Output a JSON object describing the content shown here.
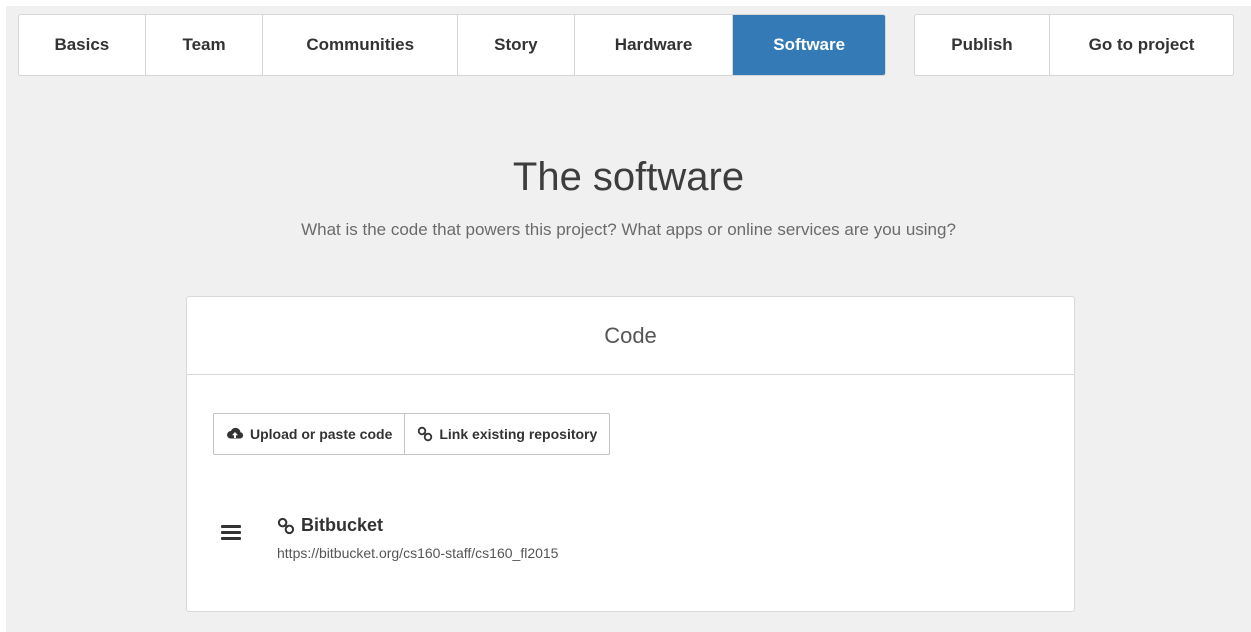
{
  "tabs_left": [
    {
      "label": "Basics",
      "active": false
    },
    {
      "label": "Team",
      "active": false
    },
    {
      "label": "Communities",
      "active": false
    },
    {
      "label": "Story",
      "active": false
    },
    {
      "label": "Hardware",
      "active": false
    },
    {
      "label": "Software",
      "active": true
    }
  ],
  "tabs_right": [
    {
      "label": "Publish"
    },
    {
      "label": "Go to project"
    }
  ],
  "page": {
    "title": "The software",
    "subtitle": "What is the code that powers this project? What apps or online services are you using?"
  },
  "code_card": {
    "header": "Code",
    "upload_button": "Upload or paste code",
    "upload_icon": "cloud-upload-icon",
    "link_button": "Link existing repository",
    "link_icon": "link-icon",
    "repository": {
      "name": "Bitbucket",
      "url": "https://bitbucket.org/cs160-staff/cs160_fl2015",
      "icon": "link-icon"
    }
  },
  "colors": {
    "accent": "#337ab7",
    "background": "#f0f0f0"
  }
}
